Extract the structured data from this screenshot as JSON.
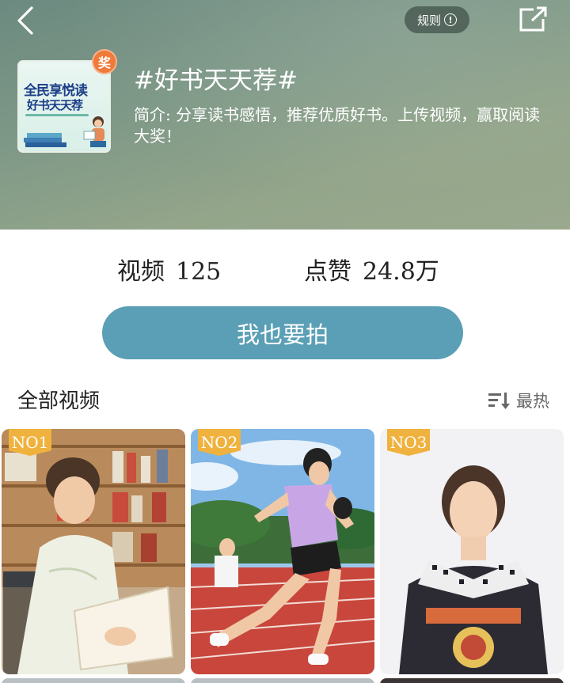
{
  "header": {
    "back_icon": "chevron-left-icon",
    "rules_label": "规则",
    "rules_icon": "info-circle-icon",
    "share_icon": "share-external-icon",
    "cover": {
      "line1": "全民享悦读",
      "line2": "好书天天荐",
      "badge": "奖"
    },
    "title": "#好书天天荐#",
    "description": "简介: 分享读书感悟，推荐优质好书。上传视频，赢取阅读大奖！"
  },
  "stats": {
    "videos_label": "视频",
    "videos_value": "125",
    "likes_label": "点赞",
    "likes_value": "24.8万"
  },
  "cta": {
    "label": "我也要拍",
    "color": "#5a9fb5"
  },
  "section": {
    "title": "全部视频",
    "sort_icon": "sort-descending-icon",
    "sort_label": "最热"
  },
  "videos": [
    {
      "rank": "NO1"
    },
    {
      "rank": "NO2"
    },
    {
      "rank": "NO3"
    }
  ],
  "colors": {
    "header_bg": "#7e9887",
    "badge": "#f0b23e",
    "award": "#f07a3a"
  }
}
